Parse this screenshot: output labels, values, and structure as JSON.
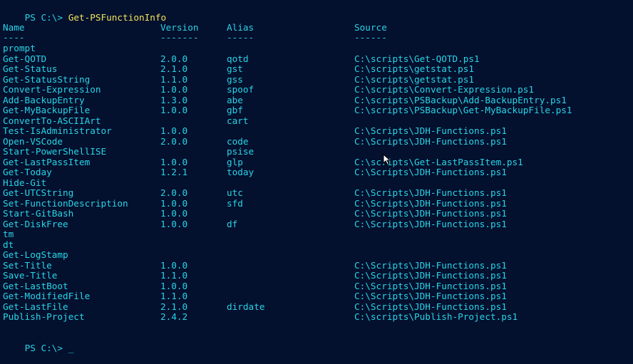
{
  "console": {
    "prompt": "PS C:\\>",
    "command": "Get-PSFunctionInfo",
    "final_prompt": "PS C:\\>",
    "cursor": "_"
  },
  "table": {
    "headers": {
      "name": "Name",
      "version": "Version",
      "alias": "Alias",
      "source": "Source"
    },
    "separators": {
      "name": "----",
      "version": "-------",
      "alias": "-----",
      "source": "------"
    },
    "rows": [
      {
        "name": "prompt",
        "version": "",
        "alias": "",
        "source": ""
      },
      {
        "name": "Get-QOTD",
        "version": "2.0.0",
        "alias": "qotd",
        "source": "C:\\scripts\\Get-QOTD.ps1"
      },
      {
        "name": "Get-Status",
        "version": "2.1.0",
        "alias": "gst",
        "source": "C:\\scripts\\getstat.ps1"
      },
      {
        "name": "Get-StatusString",
        "version": "1.1.0",
        "alias": "gss",
        "source": "C:\\scripts\\getstat.ps1"
      },
      {
        "name": "Convert-Expression",
        "version": "1.0.0",
        "alias": "spoof",
        "source": "C:\\scripts\\Convert-Expression.ps1"
      },
      {
        "name": "Add-BackupEntry",
        "version": "1.3.0",
        "alias": "abe",
        "source": "C:\\scripts\\PSBackup\\Add-BackupEntry.ps1"
      },
      {
        "name": "Get-MyBackupFile",
        "version": "1.0.0",
        "alias": "gbf",
        "source": "C:\\scripts\\PSBackup\\Get-MyBackupFile.ps1"
      },
      {
        "name": "ConvertTo-ASCIIArt",
        "version": "",
        "alias": "cart",
        "source": ""
      },
      {
        "name": "Test-IsAdministrator",
        "version": "1.0.0",
        "alias": "",
        "source": "C:\\Scripts\\JDH-Functions.ps1"
      },
      {
        "name": "Open-VSCode",
        "version": "2.0.0",
        "alias": "code",
        "source": "C:\\Scripts\\JDH-Functions.ps1"
      },
      {
        "name": "Start-PowerShellISE",
        "version": "",
        "alias": "psise",
        "source": ""
      },
      {
        "name": "Get-LastPassItem",
        "version": "1.0.0",
        "alias": "glp",
        "source": "C:\\scripts\\Get-LastPassItem.ps1"
      },
      {
        "name": "Get-Today",
        "version": "1.2.1",
        "alias": "today",
        "source": "C:\\Scripts\\JDH-Functions.ps1"
      },
      {
        "name": "Hide-Git",
        "version": "",
        "alias": "",
        "source": ""
      },
      {
        "name": "Get-UTCString",
        "version": "2.0.0",
        "alias": "utc",
        "source": "C:\\Scripts\\JDH-Functions.ps1"
      },
      {
        "name": "Set-FunctionDescription",
        "version": "1.0.0",
        "alias": "sfd",
        "source": "C:\\Scripts\\JDH-Functions.ps1"
      },
      {
        "name": "Start-GitBash",
        "version": "1.0.0",
        "alias": "",
        "source": "C:\\Scripts\\JDH-Functions.ps1"
      },
      {
        "name": "Get-DiskFree",
        "version": "1.0.0",
        "alias": "df",
        "source": "C:\\Scripts\\JDH-Functions.ps1"
      },
      {
        "name": "tm",
        "version": "",
        "alias": "",
        "source": ""
      },
      {
        "name": "dt",
        "version": "",
        "alias": "",
        "source": ""
      },
      {
        "name": "Get-LogStamp",
        "version": "",
        "alias": "",
        "source": ""
      },
      {
        "name": "Set-Title",
        "version": "1.0.0",
        "alias": "",
        "source": "C:\\Scripts\\JDH-Functions.ps1"
      },
      {
        "name": "Save-Title",
        "version": "1.1.0",
        "alias": "",
        "source": "C:\\Scripts\\JDH-Functions.ps1"
      },
      {
        "name": "Get-LastBoot",
        "version": "1.0.0",
        "alias": "",
        "source": "C:\\Scripts\\JDH-Functions.ps1"
      },
      {
        "name": "Get-ModifiedFile",
        "version": "1.1.0",
        "alias": "",
        "source": "C:\\Scripts\\JDH-Functions.ps1"
      },
      {
        "name": "Get-LastFile",
        "version": "2.1.0",
        "alias": "dirdate",
        "source": "C:\\Scripts\\JDH-Functions.ps1"
      },
      {
        "name": "Publish-Project",
        "version": "2.4.2",
        "alias": "",
        "source": "C:\\scripts\\Publish-Project.ps1"
      }
    ]
  },
  "colors": {
    "background": "#03102e",
    "output_text": "#2ad4e6",
    "command_text": "#f2e45a"
  },
  "icons": {
    "pointer": "mouse-pointer-icon"
  }
}
